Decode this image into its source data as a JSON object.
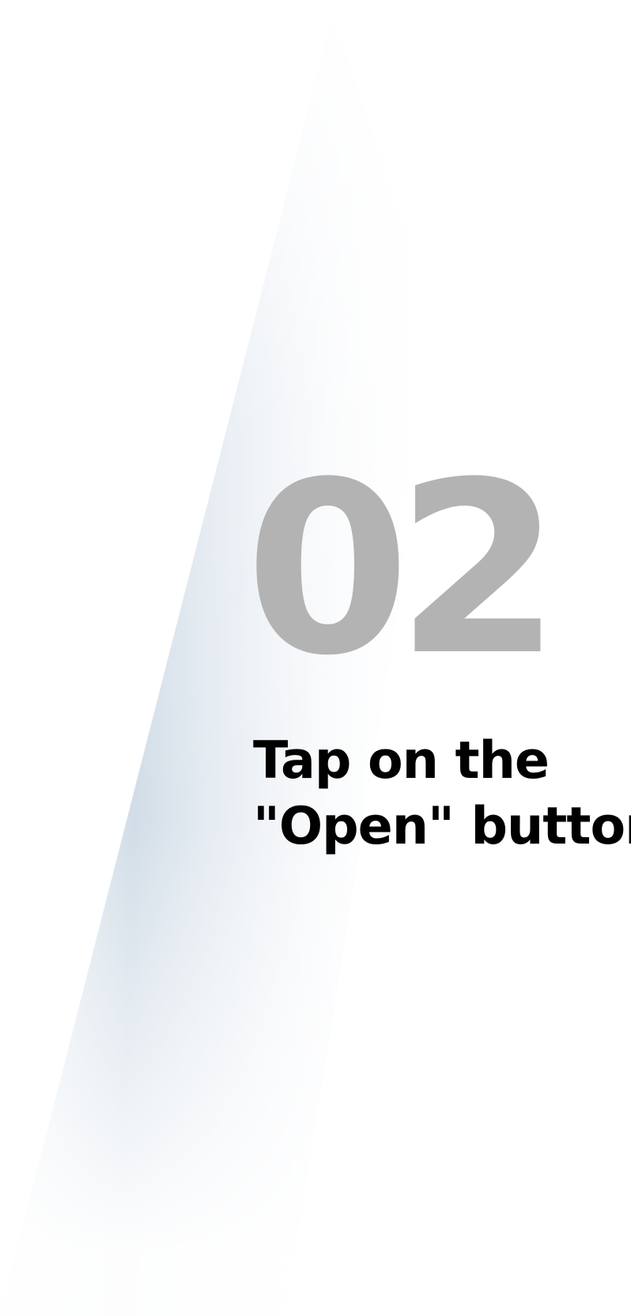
{
  "step": {
    "number": "02",
    "instruction_line1": "Tap on the",
    "instruction_line2": "\"Open\" button"
  },
  "colors": {
    "background": "#ffffff",
    "number": "#b3b3b3",
    "text": "#000000",
    "accent_shadow": "#cfdbe6"
  }
}
